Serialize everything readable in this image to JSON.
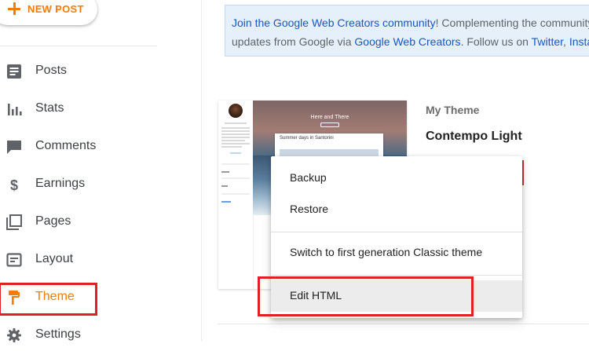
{
  "sidebar": {
    "new_post_label": "NEW POST",
    "items": [
      {
        "label": "Posts",
        "icon": "posts-icon"
      },
      {
        "label": "Stats",
        "icon": "stats-icon"
      },
      {
        "label": "Comments",
        "icon": "comments-icon"
      },
      {
        "label": "Earnings",
        "icon": "dollar-icon"
      },
      {
        "label": "Pages",
        "icon": "pages-icon"
      },
      {
        "label": "Layout",
        "icon": "layout-icon"
      },
      {
        "label": "Theme",
        "icon": "paint-roller-icon",
        "active": true
      },
      {
        "label": "Settings",
        "icon": "gear-icon"
      }
    ]
  },
  "banner": {
    "link1": "Join the Google Web Creators community",
    "text1": "! Complementing the community",
    "text2": "updates from Google via ",
    "link2": "Google Web Creators",
    "text3": ". Follow us on ",
    "link3": "Twitter",
    "text4": ", ",
    "link4": "Insta"
  },
  "theme": {
    "section_label": "My Theme",
    "name": "Contempo Light",
    "preview_title": "Here and There",
    "preview_post_title": "Summer days in Santorini"
  },
  "menu": {
    "items": [
      "Backup",
      "Restore",
      "Switch to first generation Classic theme",
      "Edit HTML"
    ]
  },
  "colors": {
    "accent": "#f57c00",
    "highlight_box": "#e02027",
    "link": "#1a55c6"
  }
}
